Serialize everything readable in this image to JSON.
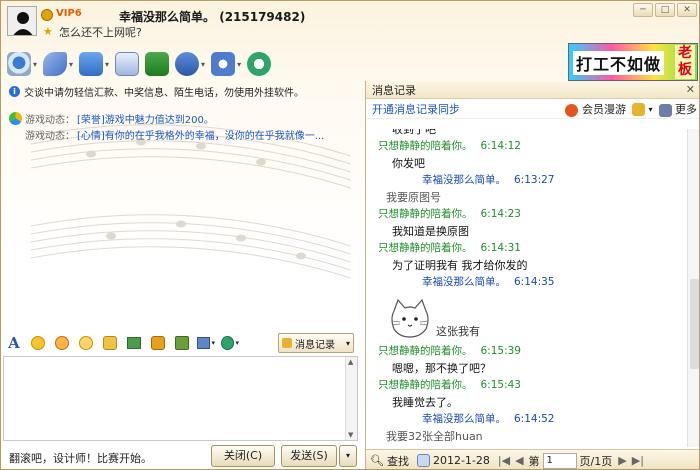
{
  "title": {
    "vip_label": "VIP6",
    "buddy_name": "幸福没那么简单。",
    "buddy_qq": "(215179482)",
    "signature": "怎么还不上网呢?"
  },
  "banner": {
    "text": "打工不如做",
    "tag": "老板"
  },
  "chat": {
    "notice": "交谈中请勿轻信汇款、中奖信息、陌生电话，勿使用外挂软件。",
    "game_updates": [
      {
        "label": "游戏动态：",
        "text": "[荣誉]游戏中魅力值达到200。"
      },
      {
        "label": "游戏动态：",
        "text": "[心情]有你的在乎我格外的幸福，没你的在乎我就像一..."
      }
    ]
  },
  "format_toolbar": {
    "msglog_label": "消息记录"
  },
  "footer": {
    "hint": "翻滚吧，设计师！比赛开始。",
    "close_label": "关闭(C)",
    "send_label": "发送(S)"
  },
  "history_panel": {
    "title": "消息记录",
    "sync_link": "开通消息记录同步",
    "member_label": "会员漫游",
    "more_label": "更多",
    "messages": [
      {
        "type": "body",
        "text": "收到了吧"
      },
      {
        "type": "head",
        "who": "只想静静的陪着你。",
        "time": "6:14:12",
        "color": "green"
      },
      {
        "type": "body",
        "text": "你发吧"
      },
      {
        "type": "head",
        "who": "幸福没那么简单。",
        "time": "6:13:27",
        "color": "blue"
      },
      {
        "type": "body",
        "text": "我要原图号",
        "self": true
      },
      {
        "type": "head",
        "who": "只想静静的陪着你。",
        "time": "6:14:23",
        "color": "green"
      },
      {
        "type": "body",
        "text": "我知道是换原图"
      },
      {
        "type": "head",
        "who": "只想静静的陪着你。",
        "time": "6:14:31",
        "color": "green"
      },
      {
        "type": "body",
        "text": "为了证明我有  我才给你发的"
      },
      {
        "type": "head",
        "who": "幸福没那么简单。",
        "time": "6:14:35",
        "color": "blue"
      },
      {
        "type": "sticker",
        "caption": "这张我有"
      },
      {
        "type": "head",
        "who": "只想静静的陪着你。",
        "time": "6:15:39",
        "color": "green"
      },
      {
        "type": "body",
        "text": "嗯嗯，那不换了吧？"
      },
      {
        "type": "head",
        "who": "只想静静的陪着你。",
        "time": "6:15:43",
        "color": "green"
      },
      {
        "type": "body",
        "text": "我睡觉去了。"
      },
      {
        "type": "head",
        "who": "幸福没那么简单。",
        "time": "6:14:52",
        "color": "blue"
      },
      {
        "type": "body",
        "text": "我要32张全部huan",
        "self": true
      }
    ],
    "footer": {
      "search_label": "查找",
      "date": "2012-1-28",
      "page_prefix": "第",
      "page_value": "1",
      "page_total": "页/1页"
    }
  },
  "colors": {
    "frame": "#b89a63",
    "green_sender": "#1f8f2a",
    "blue_sender": "#1a48b8",
    "link": "#1a56c8"
  }
}
